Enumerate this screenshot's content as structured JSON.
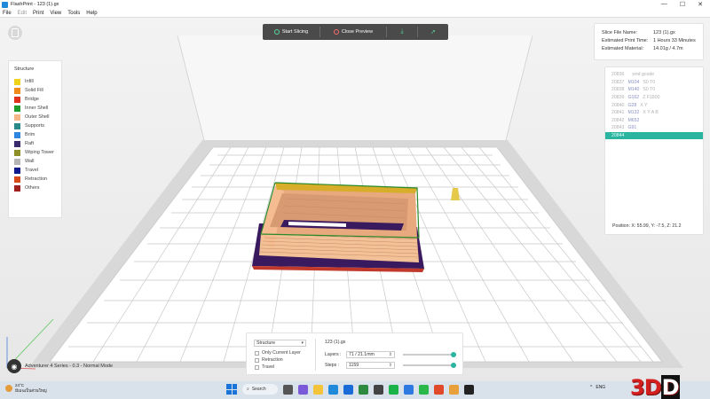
{
  "window": {
    "title": "FlashPrint - 123 (1).gx",
    "controls": [
      "—",
      "☐",
      "✕"
    ]
  },
  "menu": {
    "items": [
      "File",
      "Edit",
      "Print",
      "View",
      "Tools",
      "Help"
    ]
  },
  "toolbar": {
    "start_slicing": "Start Slicing",
    "close_preview": "Close Preview"
  },
  "legend": {
    "title": "Structure",
    "items": [
      {
        "label": "Infill",
        "color": "#f0d21a"
      },
      {
        "label": "Solid Fill",
        "color": "#f08a1a"
      },
      {
        "label": "Bridge",
        "color": "#e0301e"
      },
      {
        "label": "Inner Shell",
        "color": "#1f9a2e"
      },
      {
        "label": "Outer Shell",
        "color": "#f5b68a"
      },
      {
        "label": "Supports",
        "color": "#2a8a8a"
      },
      {
        "label": "Brim",
        "color": "#2f86e0"
      },
      {
        "label": "Raft",
        "color": "#3a2a6e"
      },
      {
        "label": "Wiping Tower",
        "color": "#8f8f2a"
      },
      {
        "label": "Wall",
        "color": "#b5b5b5"
      },
      {
        "label": "Travel",
        "color": "#101a8a"
      },
      {
        "label": "Retraction",
        "color": "#d84a1a"
      },
      {
        "label": "Others",
        "color": "#a02020"
      }
    ]
  },
  "info": {
    "rows": [
      {
        "k": "Slice File Name:",
        "v": "123 (1).gx"
      },
      {
        "k": "Estimated Print Time:",
        "v": "1 Hours 33 Minutes"
      },
      {
        "k": "Estimated Material:",
        "v": "14.01g / 4.7m"
      }
    ]
  },
  "gcode": {
    "lines": [
      {
        "n": "20836",
        "cmd": "",
        "arg": ";end gcode"
      },
      {
        "n": "20837",
        "cmd": "M104",
        "arg": "S0 T0"
      },
      {
        "n": "20838",
        "cmd": "M140",
        "arg": "S0 T0"
      },
      {
        "n": "20839",
        "cmd": "G162",
        "arg": "Z F1800"
      },
      {
        "n": "20840",
        "cmd": "G28",
        "arg": "X Y"
      },
      {
        "n": "20841",
        "cmd": "M132",
        "arg": "X Y A B"
      },
      {
        "n": "20842",
        "cmd": "M652",
        "arg": ""
      },
      {
        "n": "20843",
        "cmd": "G91",
        "arg": ""
      },
      {
        "n": "20844",
        "cmd": "",
        "arg": ""
      }
    ],
    "position": "Position:  X: 55.99, Y: -7.5, Z: 21.2"
  },
  "bottom": {
    "view_mode": "Structure",
    "checks": [
      "Only Current Layer",
      "Retraction",
      "Travel"
    ],
    "file": "123 (1).gx",
    "layers_label": "Layers :",
    "layers_value": "71 / 21.1mm",
    "steps_label": "Steps :",
    "steps_value": "1159",
    "layers_progress": 1.0,
    "steps_progress": 1.0
  },
  "machine": {
    "label": "Adventurer 4 Series - 0.3 - Normal Mode"
  },
  "taskbar": {
    "temp": "24°C",
    "weather": "มีเมฆเป็นส่วนใหญ่",
    "search": "Search",
    "lang": "ENG",
    "brand": "3D",
    "brand2": "D"
  },
  "colors": {
    "accent": "#2bb5a0",
    "toolbar": "#4a4a4a",
    "raft": "#3a1a5e",
    "outer_shell": "#f5b68a"
  }
}
